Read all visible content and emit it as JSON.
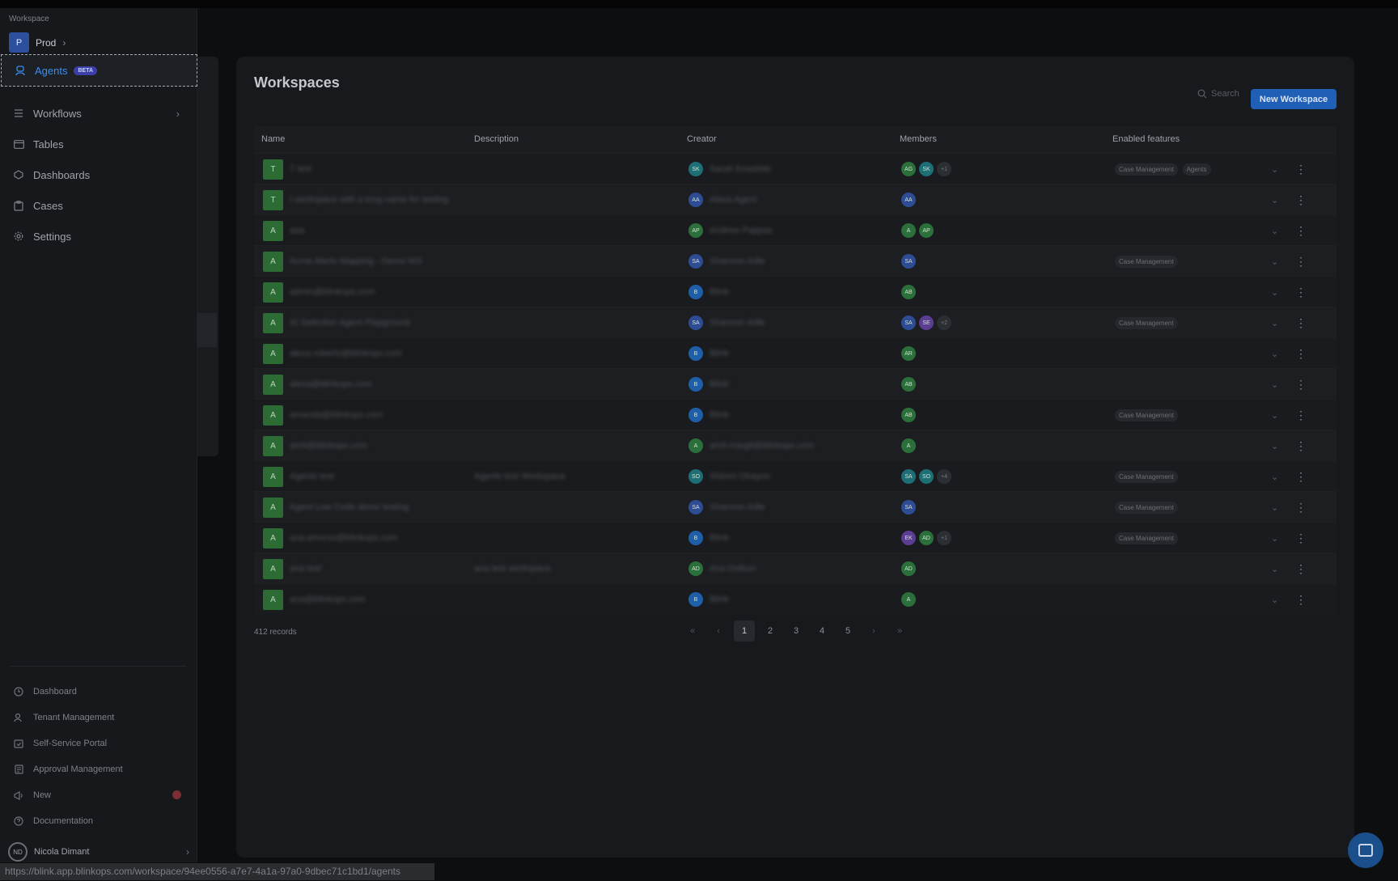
{
  "sidebar": {
    "workspace_label": "Workspace",
    "workspace_badge": "P",
    "workspace_name": "Prod",
    "nav": [
      {
        "label": "Agents",
        "badge": "BETA",
        "icon": "agent-icon",
        "active": true
      },
      {
        "label": "Workflows",
        "icon": "workflow-icon",
        "has_children": true
      },
      {
        "label": "Tables",
        "icon": "table-icon"
      },
      {
        "label": "Dashboards",
        "icon": "dashboard-icon"
      },
      {
        "label": "Cases",
        "icon": "case-icon"
      },
      {
        "label": "Settings",
        "icon": "gear-icon"
      }
    ],
    "bottom": [
      {
        "label": "Dashboard",
        "icon": "clock-icon"
      },
      {
        "label": "Tenant Management",
        "icon": "tenant-icon"
      },
      {
        "label": "Self-Service Portal",
        "icon": "portal-icon"
      },
      {
        "label": "Approval Management",
        "icon": "approval-icon"
      },
      {
        "label": "New",
        "icon": "megaphone-icon"
      },
      {
        "label": "Documentation",
        "icon": "help-icon"
      }
    ],
    "user_name": "Nicola Dimant",
    "user_initials": "ND"
  },
  "main": {
    "title": "Workspaces",
    "search_placeholder": "Search",
    "new_button": "New Workspace",
    "columns": [
      "Name",
      "Description",
      "Creator",
      "Members",
      "Enabled features"
    ],
    "rows": [
      {
        "badge": "T",
        "name": "T test",
        "desc": "",
        "creator_av": "SK",
        "creator_color": "teal",
        "creator": "Sarah Kowalski",
        "members": [
          [
            "AG",
            "green"
          ],
          [
            "SK",
            "teal"
          ]
        ],
        "more": "+1",
        "tags": [
          "Case Management",
          "Agents"
        ]
      },
      {
        "badge": "T",
        "name": "t workspace with a long name for testing",
        "desc": "",
        "creator_av": "AA",
        "creator_color": "blue",
        "creator": "Alexa Agent",
        "members": [
          [
            "AA",
            "blue"
          ]
        ],
        "more": "",
        "tags": []
      },
      {
        "badge": "A",
        "name": "aaa",
        "desc": "",
        "creator_av": "AP",
        "creator_color": "green",
        "creator": "Andrew Pappas",
        "members": [
          [
            "A",
            "green"
          ],
          [
            "AP",
            "green"
          ]
        ],
        "more": "",
        "tags": []
      },
      {
        "badge": "A",
        "name": "Acme Alerts Mapping - Demo WS",
        "desc": "",
        "creator_av": "SA",
        "creator_color": "blue",
        "creator": "Shannon Adle",
        "members": [
          [
            "SA",
            "blue"
          ]
        ],
        "more": "",
        "tags": [
          "Case Management"
        ]
      },
      {
        "badge": "A",
        "name": "admin@blinkops.com",
        "desc": "",
        "creator_av": "B",
        "creator_color": "sky",
        "creator": "Blink",
        "members": [
          [
            "AB",
            "green"
          ]
        ],
        "more": "",
        "tags": []
      },
      {
        "badge": "A",
        "name": "AI Selection Agent Playground",
        "desc": "",
        "creator_av": "SA",
        "creator_color": "blue",
        "creator": "Shannon Adle",
        "members": [
          [
            "SA",
            "blue"
          ],
          [
            "SE",
            "purple"
          ]
        ],
        "more": "+2",
        "tags": [
          "Case Management"
        ]
      },
      {
        "badge": "A",
        "name": "alexa.roberts@blinkops.com",
        "desc": "",
        "creator_av": "B",
        "creator_color": "sky",
        "creator": "Blink",
        "members": [
          [
            "AR",
            "green"
          ]
        ],
        "more": "",
        "tags": []
      },
      {
        "badge": "A",
        "name": "alexa@blinkops.com",
        "desc": "",
        "creator_av": "B",
        "creator_color": "sky",
        "creator": "Blink",
        "members": [
          [
            "AB",
            "green"
          ]
        ],
        "more": "",
        "tags": []
      },
      {
        "badge": "A",
        "name": "amanda@blinkops.com",
        "desc": "",
        "creator_av": "B",
        "creator_color": "sky",
        "creator": "Blink",
        "members": [
          [
            "AB",
            "green"
          ]
        ],
        "more": "",
        "tags": [
          "Case Management"
        ]
      },
      {
        "badge": "A",
        "name": "amit@blinkops.com",
        "desc": "",
        "creator_av": "A",
        "creator_color": "green",
        "creator": "amit.margil@blinkops.com",
        "members": [
          [
            "A",
            "green"
          ]
        ],
        "more": "",
        "tags": []
      },
      {
        "badge": "A",
        "name": "Agents test",
        "desc": "Agents test Workspace",
        "creator_av": "SO",
        "creator_color": "teal",
        "creator": "Shlomi Ohayon",
        "members": [
          [
            "SA",
            "teal"
          ],
          [
            "SO",
            "teal"
          ]
        ],
        "more": "+4",
        "tags": [
          "Case Management"
        ]
      },
      {
        "badge": "A",
        "name": "Agent Low Code demo testing",
        "desc": "",
        "creator_av": "SA",
        "creator_color": "blue",
        "creator": "Shannon Adle",
        "members": [
          [
            "SA",
            "blue"
          ]
        ],
        "more": "",
        "tags": [
          "Case Management"
        ]
      },
      {
        "badge": "A",
        "name": "ana.amoros@blinkops.com",
        "desc": "",
        "creator_av": "B",
        "creator_color": "sky",
        "creator": "Blink",
        "members": [
          [
            "EK",
            "purple"
          ],
          [
            "AD",
            "green"
          ]
        ],
        "more": "+1",
        "tags": [
          "Case Management"
        ]
      },
      {
        "badge": "A",
        "name": "ana test",
        "desc": "ana test workspace",
        "creator_av": "AD",
        "creator_color": "green",
        "creator": "Ana Dolhun",
        "members": [
          [
            "AD",
            "green"
          ]
        ],
        "more": "",
        "tags": []
      },
      {
        "badge": "A",
        "name": "ana@blinkops.com",
        "desc": "",
        "creator_av": "B",
        "creator_color": "sky",
        "creator": "Blink",
        "members": [
          [
            "A",
            "green"
          ]
        ],
        "more": "",
        "tags": []
      }
    ],
    "records": "412 records",
    "pages": [
      "1",
      "2",
      "3",
      "4",
      "5"
    ],
    "current_page": "1"
  },
  "status_url": "https://blink.app.blinkops.com/workspace/94ee0556-a7e7-4a1a-97a0-9dbec71c1bd1/agents",
  "colors": {
    "accent": "#3d8ef0",
    "primary_button": "#1f5fb5",
    "name_badge": "#2c6b33"
  }
}
